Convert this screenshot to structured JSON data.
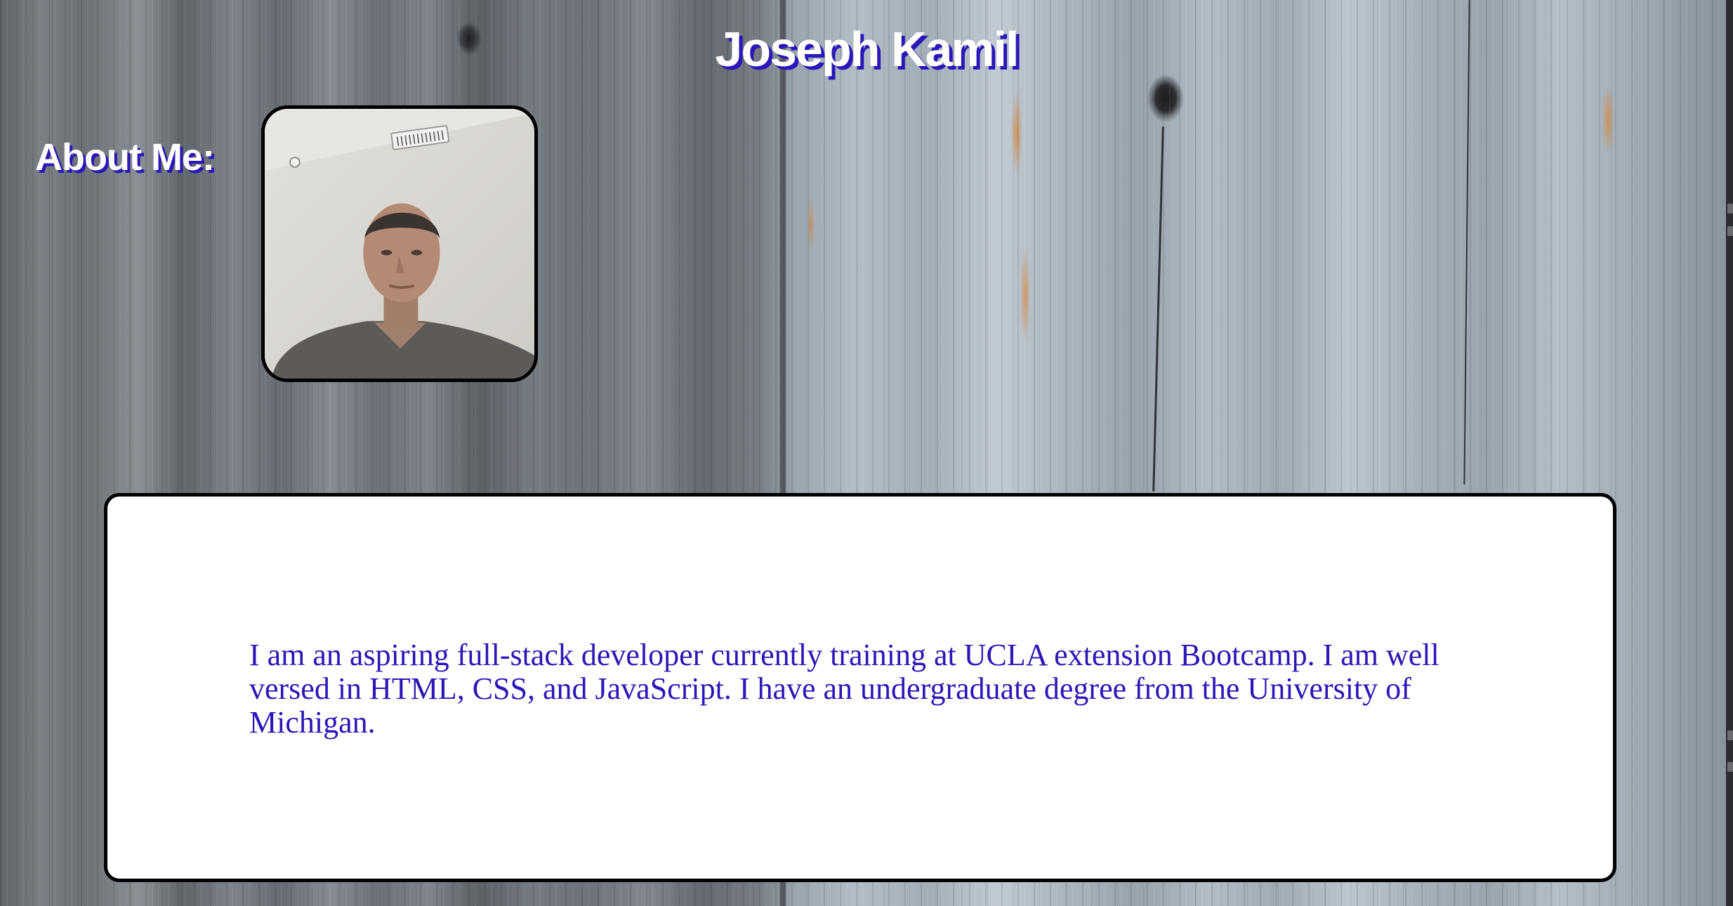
{
  "header": {
    "name": "Joseph Kamil"
  },
  "about": {
    "heading": "About Me:",
    "photo_alt": "Joseph Kamil",
    "bio": "I am an aspiring full-stack developer currently training at UCLA extension Bootcamp. I am well versed in HTML, CSS, and JavaScript. I have an undergraduate degree from the University of Michigan."
  },
  "theme": {
    "heading_color": "#ffffff",
    "shadow_color": "#2a17b8",
    "bio_text_color": "#2a17b8",
    "card_background": "#ffffff"
  }
}
